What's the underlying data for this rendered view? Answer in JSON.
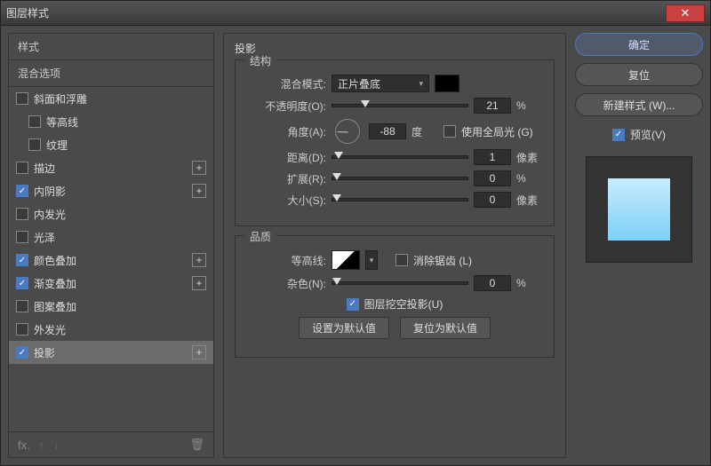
{
  "window": {
    "title": "图层样式"
  },
  "left": {
    "header_styles": "样式",
    "header_blend": "混合选项",
    "items": [
      {
        "label": "斜面和浮雕",
        "checked": false,
        "plus": false
      },
      {
        "label": "等高线",
        "checked": false,
        "plus": false
      },
      {
        "label": "纹理",
        "checked": false,
        "plus": false
      },
      {
        "label": "描边",
        "checked": false,
        "plus": true
      },
      {
        "label": "内阴影",
        "checked": true,
        "plus": true
      },
      {
        "label": "内发光",
        "checked": false,
        "plus": false
      },
      {
        "label": "光泽",
        "checked": false,
        "plus": false
      },
      {
        "label": "颜色叠加",
        "checked": true,
        "plus": true
      },
      {
        "label": "渐变叠加",
        "checked": true,
        "plus": true
      },
      {
        "label": "图案叠加",
        "checked": false,
        "plus": false
      },
      {
        "label": "外发光",
        "checked": false,
        "plus": false
      },
      {
        "label": "投影",
        "checked": true,
        "plus": true,
        "selected": true
      }
    ]
  },
  "center": {
    "title": "投影",
    "structure": {
      "title": "结构",
      "blend_mode_label": "混合模式:",
      "blend_mode_value": "正片叠底",
      "opacity_label": "不透明度(O):",
      "opacity_value": "21",
      "opacity_unit": "%",
      "angle_label": "角度(A):",
      "angle_value": "-88",
      "angle_unit": "度",
      "global_light_label": "使用全局光 (G)",
      "global_light_checked": false,
      "distance_label": "距离(D):",
      "distance_value": "1",
      "distance_unit": "像素",
      "spread_label": "扩展(R):",
      "spread_value": "0",
      "spread_unit": "%",
      "size_label": "大小(S):",
      "size_value": "0",
      "size_unit": "像素"
    },
    "quality": {
      "title": "品质",
      "contour_label": "等高线:",
      "antialias_label": "消除锯齿 (L)",
      "antialias_checked": false,
      "noise_label": "杂色(N):",
      "noise_value": "0",
      "noise_unit": "%",
      "knockout_checked": true,
      "knockout_label": "图层挖空投影(U)",
      "btn_default": "设置为默认值",
      "btn_reset": "复位为默认值"
    }
  },
  "right": {
    "ok": "确定",
    "cancel": "复位",
    "new_style": "新建样式 (W)...",
    "preview_label": "预览(V)",
    "preview_checked": true
  }
}
